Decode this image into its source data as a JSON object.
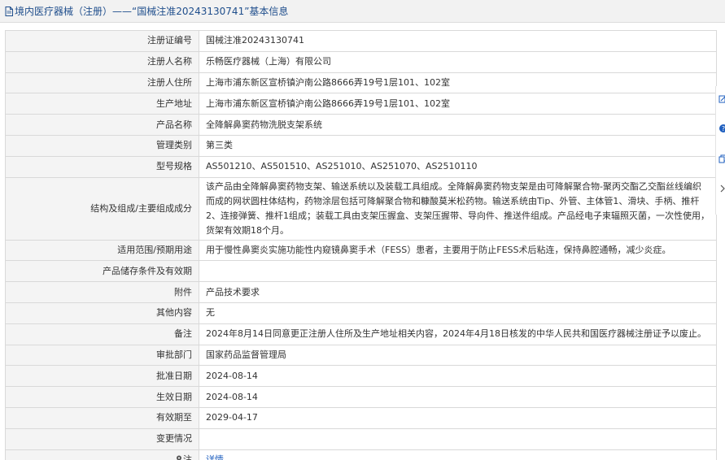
{
  "header": {
    "title": "境内医疗器械（注册）——“国械注准20243130741”基本信息"
  },
  "rows": [
    {
      "label": "注册证编号",
      "value": "国械注准20243130741"
    },
    {
      "label": "注册人名称",
      "value": "乐畅医疗器械（上海）有限公司"
    },
    {
      "label": "注册人住所",
      "value": "上海市浦东新区宣桥镇沪南公路8666弄19号1层101、102室"
    },
    {
      "label": "生产地址",
      "value": "上海市浦东新区宣桥镇沪南公路8666弄19号1层101、102室"
    },
    {
      "label": "产品名称",
      "value": "全降解鼻窦药物洗脱支架系统"
    },
    {
      "label": "管理类别",
      "value": "第三类"
    },
    {
      "label": "型号规格",
      "value": "AS501210、AS501510、AS251010、AS251070、AS2510110"
    },
    {
      "label": "结构及组成/主要组成成分",
      "value": "该产品由全降解鼻窦药物支架、输送系统以及装载工具组成。全降解鼻窦药物支架是由可降解聚合物-聚丙交酯乙交酯丝线编织而成的网状圆柱体结构，药物涂层包括可降解聚合物和糠酸莫米松药物。输送系统由Tip、外管、主体管1、滑块、手柄、推杆2、连接弹簧、推杆1组成；装载工具由支架压握盒、支架压握带、导向件、推送件组成。产品经电子束辐照灭菌，一次性使用，货架有效期18个月。"
    },
    {
      "label": "适用范围/预期用途",
      "value": "用于慢性鼻窦炎实施功能性内窥镜鼻窦手术（FESS）患者，主要用于防止FESS术后粘连，保持鼻腔通畅，减少炎症。"
    },
    {
      "label": "产品储存条件及有效期",
      "value": ""
    },
    {
      "label": "附件",
      "value": "产品技术要求"
    },
    {
      "label": "其他内容",
      "value": "无"
    },
    {
      "label": "备注",
      "value": "2024年8月14日同意更正注册人住所及生产地址相关内容，2024年4月18日核发的中华人民共和国医疗器械注册证予以废止。"
    },
    {
      "label": "审批部门",
      "value": "国家药品监督管理局"
    },
    {
      "label": "批准日期",
      "value": "2024-08-14"
    },
    {
      "label": "生效日期",
      "value": "2024-08-14"
    },
    {
      "label": "有效期至",
      "value": "2029-04-17"
    },
    {
      "label": "变更情况",
      "value": ""
    }
  ],
  "note_row": {
    "label": "注",
    "link": "详情"
  },
  "icons": {
    "title": "document-icon",
    "note": "pin-icon",
    "side": [
      "edit-icon",
      "help-icon",
      "copy-icon",
      "chevron-right-icon"
    ]
  },
  "colors": {
    "title_text": "#1f4e8c",
    "link": "#1f5fbf",
    "label_bg": "#f4f4f4",
    "border": "#d9d9d9",
    "help": "#1f5fbf"
  }
}
